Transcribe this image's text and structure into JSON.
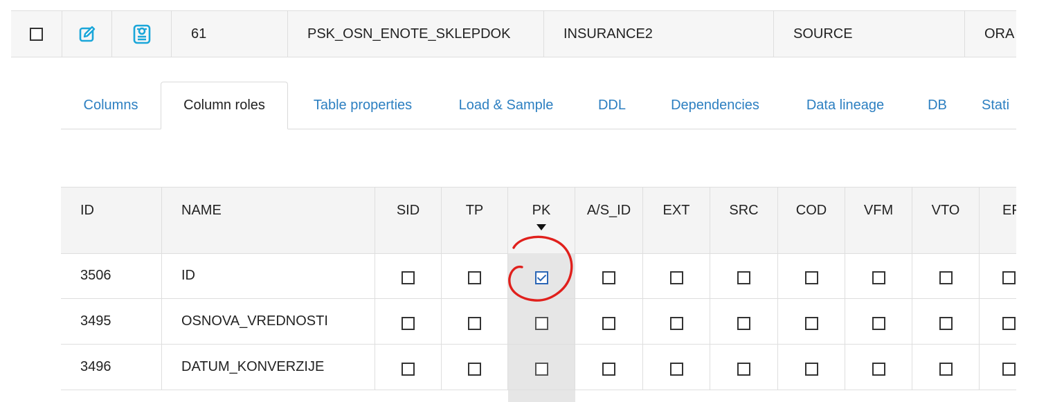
{
  "top_row": {
    "id": "61",
    "table_name": "PSK_OSN_ENOTE_SKLEPDOK",
    "schema": "INSURANCE2",
    "type": "SOURCE",
    "db": "ORA",
    "icons": [
      "edit-icon",
      "profile-card-icon"
    ]
  },
  "tabs": [
    {
      "label": "Columns",
      "active": false
    },
    {
      "label": "Column roles",
      "active": true
    },
    {
      "label": "Table properties",
      "active": false
    },
    {
      "label": "Load & Sample",
      "active": false
    },
    {
      "label": "DDL",
      "active": false
    },
    {
      "label": "Dependencies",
      "active": false
    },
    {
      "label": "Data lineage",
      "active": false
    },
    {
      "label": "DB",
      "active": false
    },
    {
      "label": "Stati",
      "active": false
    }
  ],
  "grid": {
    "headers": {
      "id": "ID",
      "name": "NAME",
      "sid": "SID",
      "tp": "TP",
      "pk": "PK",
      "as_id": "A/S_ID",
      "ext": "EXT",
      "src": "SRC",
      "cod": "COD",
      "vfm": "VFM",
      "vto": "VTO",
      "ef": "EF"
    },
    "sort_column": "PK",
    "rows": [
      {
        "id": "3506",
        "name": "ID",
        "pk_checked": true
      },
      {
        "id": "3495",
        "name": "OSNOVA_VREDNOSTI",
        "pk_checked": false
      },
      {
        "id": "3496",
        "name": "DATUM_KONVERZIJE",
        "pk_checked": false
      }
    ]
  },
  "colors": {
    "link": "#2c7fc1",
    "icon": "#1aa6d9",
    "annotation": "#e0201c",
    "check": "#2a66b6"
  }
}
